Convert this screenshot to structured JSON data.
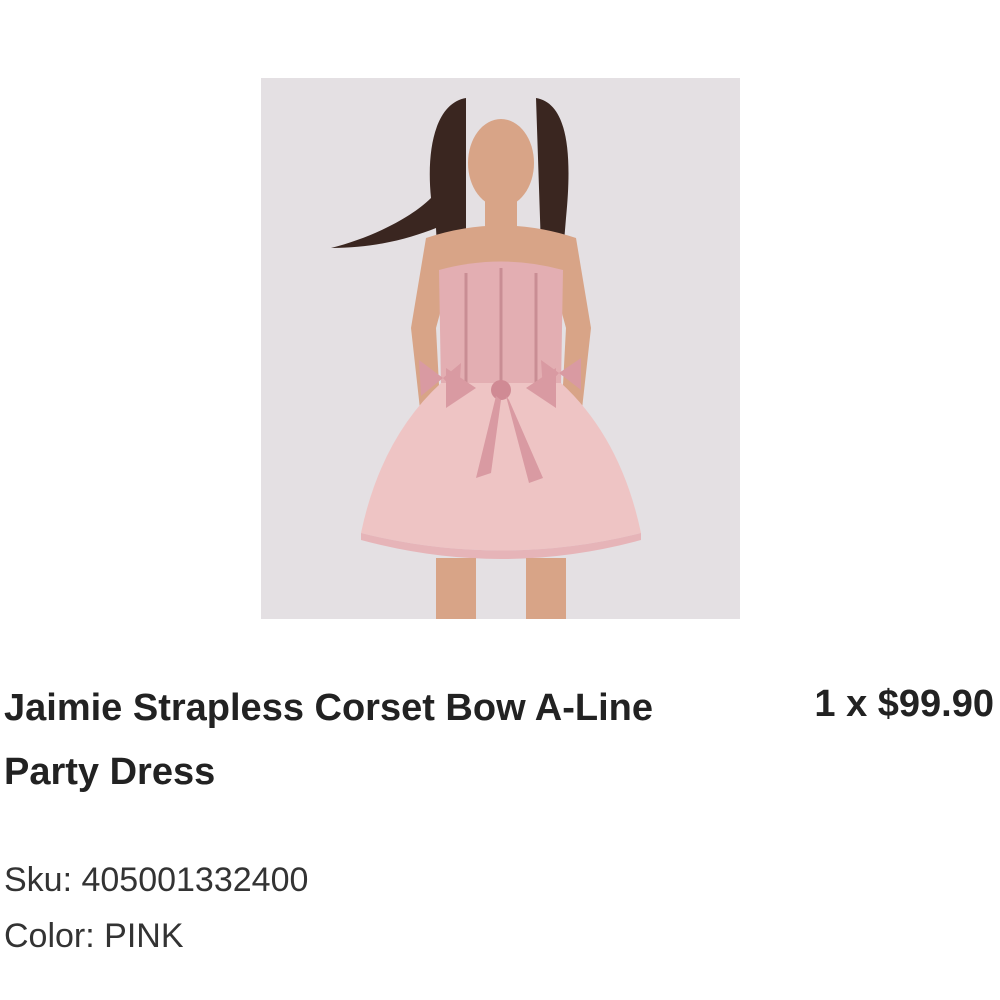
{
  "product": {
    "title": "Jaimie Strapless Corset Bow A-Line Party Dress",
    "quantity_price": "1 x $99.90",
    "sku_label": "Sku: 405001332400",
    "color_label": "Color: PINK"
  },
  "image": {
    "icon": "product-photo",
    "background_color": "#e4e0e3",
    "dress_color": "#e6b4b8"
  }
}
